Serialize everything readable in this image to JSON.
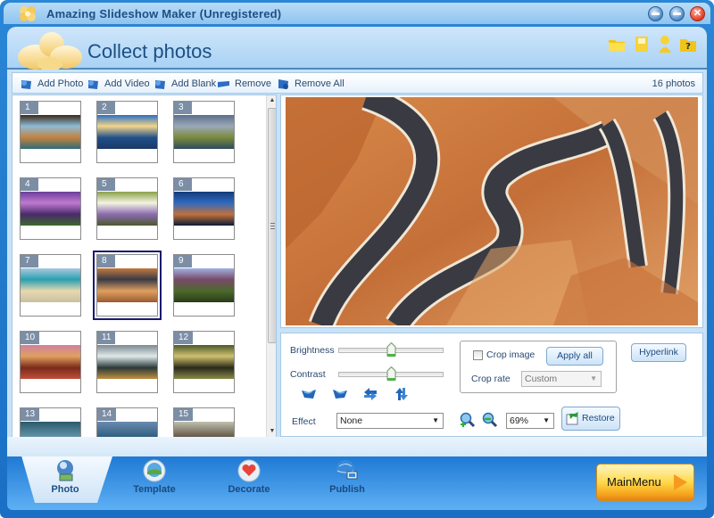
{
  "window": {
    "title": "Amazing Slideshow Maker (Unregistered)",
    "controls": [
      "minimize",
      "maximize",
      "close"
    ]
  },
  "header": {
    "page_title": "Collect photos",
    "icons": [
      "open-folder-icon",
      "save-icon",
      "user-icon",
      "help-icon"
    ]
  },
  "toolbar": {
    "add_photo": "Add Photo",
    "add_video": "Add Video",
    "add_blank": "Add Blank",
    "remove": "Remove",
    "remove_all": "Remove All",
    "photo_count": "16 photos"
  },
  "thumbnails": {
    "selected": "8",
    "items": [
      {
        "num": "1",
        "colors": [
          "#3a2a1a",
          "#8fbbd6",
          "#c2813e",
          "#2e6c7a"
        ]
      },
      {
        "num": "2",
        "colors": [
          "#2a6fc4",
          "#f3d58a",
          "#1f4f8a",
          "#1a3a66"
        ]
      },
      {
        "num": "3",
        "colors": [
          "#5a6f8a",
          "#9aa9b8",
          "#7a8a3a",
          "#2c4a60"
        ]
      },
      {
        "num": "4",
        "colors": [
          "#6a3f9a",
          "#c07ad0",
          "#4a2a6a",
          "#3a6a2a"
        ]
      },
      {
        "num": "5",
        "colors": [
          "#8aa04a",
          "#f4f4e0",
          "#8a6ab0",
          "#4a5a2a"
        ]
      },
      {
        "num": "6",
        "colors": [
          "#143a7a",
          "#2f6ac0",
          "#c0703a",
          "#0a1a3a"
        ]
      },
      {
        "num": "7",
        "colors": [
          "#a8c8e0",
          "#2aa0b0",
          "#e8d8b0",
          "#c8c0a0"
        ]
      },
      {
        "num": "8",
        "colors": [
          "#c07a40",
          "#3a3a44",
          "#e0a060",
          "#9a5a30"
        ]
      },
      {
        "num": "9",
        "colors": [
          "#a0b0e0",
          "#7a4a6a",
          "#4a6a2a",
          "#2a3a1a"
        ]
      },
      {
        "num": "10",
        "colors": [
          "#d080a0",
          "#e0a060",
          "#7a2a1a",
          "#c0503a"
        ]
      },
      {
        "num": "11",
        "colors": [
          "#7a8a90",
          "#e0e8ea",
          "#2a3a3a",
          "#c09040"
        ]
      },
      {
        "num": "12",
        "colors": [
          "#4a5a2a",
          "#d0c070",
          "#2a2a1a",
          "#8a8a4a"
        ]
      },
      {
        "num": "13",
        "colors": [
          "#2a5a6a",
          "#6a9ab0",
          "#3a5a3a"
        ]
      },
      {
        "num": "14",
        "colors": [
          "#6a8ab0",
          "#2a5a7a",
          "#a0b0c0"
        ]
      },
      {
        "num": "15",
        "colors": [
          "#c0c0b0",
          "#5a4a3a",
          "#e0d0a0"
        ]
      }
    ]
  },
  "preview": {
    "description": "winding mountain road through orange canyon",
    "colors": {
      "rock": "#c8753c",
      "rock_light": "#e6a56a",
      "road": "#3a3b42",
      "wall": "#f0e6d6"
    }
  },
  "controls": {
    "brightness_label": "Brightness",
    "brightness_value": 0.5,
    "contrast_label": "Contrast",
    "contrast_value": 0.5,
    "rotate_icons": [
      "rotate-left-icon",
      "rotate-right-icon",
      "flip-horizontal-icon",
      "flip-vertical-icon"
    ],
    "effect_label": "Effect",
    "effect_value": "None",
    "crop_image_label": "Crop image",
    "crop_image_checked": false,
    "apply_all_label": "Apply all",
    "crop_rate_label": "Crop rate",
    "crop_rate_value": "Custom",
    "hyperlink_label": "Hyperlink",
    "zoom_value": "69%",
    "restore_label": "Restore"
  },
  "nav": {
    "tabs": [
      {
        "label": "Photo",
        "active": true
      },
      {
        "label": "Template",
        "active": false
      },
      {
        "label": "Decorate",
        "active": false
      },
      {
        "label": "Publish",
        "active": false
      }
    ],
    "main_menu_label": "MainMenu"
  }
}
